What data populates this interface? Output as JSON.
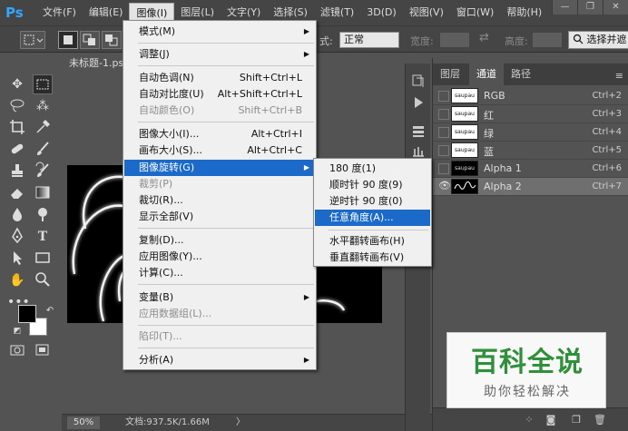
{
  "app": {
    "logo": "Ps"
  },
  "menubar": {
    "items": [
      "文件(F)",
      "编辑(E)",
      "图像(I)",
      "图层(L)",
      "文字(Y)",
      "选择(S)",
      "滤镜(T)",
      "3D(D)",
      "视图(V)",
      "窗口(W)",
      "帮助(H)"
    ],
    "active_index": 2
  },
  "window_controls": {
    "minimize": "—",
    "restore": "❐",
    "close": "✕"
  },
  "options_bar": {
    "style_label": "式:",
    "style_value": "正常",
    "width_label": "宽度:",
    "height_label": "高度:",
    "select_mask_button": "选择并遮"
  },
  "document": {
    "tab_title": "未标题-1.psd",
    "zoom": "50%",
    "doc_info": "文档:937.5K/1.66M",
    "status_arrow": "〉"
  },
  "image_menu": {
    "items": [
      {
        "label": "模式(M)",
        "shortcut": "",
        "submenu": true,
        "disabled": false
      },
      {
        "label": "调整(J)",
        "shortcut": "",
        "submenu": true,
        "disabled": false
      },
      {
        "label": "自动色调(N)",
        "shortcut": "Shift+Ctrl+L",
        "submenu": false,
        "disabled": false
      },
      {
        "label": "自动对比度(U)",
        "shortcut": "Alt+Shift+Ctrl+L",
        "submenu": false,
        "disabled": false
      },
      {
        "label": "自动颜色(O)",
        "shortcut": "Shift+Ctrl+B",
        "submenu": false,
        "disabled": true
      },
      {
        "label": "图像大小(I)...",
        "shortcut": "Alt+Ctrl+I",
        "submenu": false,
        "disabled": false
      },
      {
        "label": "画布大小(S)...",
        "shortcut": "Alt+Ctrl+C",
        "submenu": false,
        "disabled": false
      },
      {
        "label": "图像旋转(G)",
        "shortcut": "",
        "submenu": true,
        "disabled": false,
        "highlighted": true
      },
      {
        "label": "裁剪(P)",
        "shortcut": "",
        "submenu": false,
        "disabled": true
      },
      {
        "label": "裁切(R)...",
        "shortcut": "",
        "submenu": false,
        "disabled": false
      },
      {
        "label": "显示全部(V)",
        "shortcut": "",
        "submenu": false,
        "disabled": false
      },
      {
        "label": "复制(D)...",
        "shortcut": "",
        "submenu": false,
        "disabled": false
      },
      {
        "label": "应用图像(Y)...",
        "shortcut": "",
        "submenu": false,
        "disabled": false
      },
      {
        "label": "计算(C)...",
        "shortcut": "",
        "submenu": false,
        "disabled": false
      },
      {
        "label": "变量(B)",
        "shortcut": "",
        "submenu": true,
        "disabled": false
      },
      {
        "label": "应用数据组(L)...",
        "shortcut": "",
        "submenu": false,
        "disabled": true
      },
      {
        "label": "陷印(T)...",
        "shortcut": "",
        "submenu": false,
        "disabled": true
      },
      {
        "label": "分析(A)",
        "shortcut": "",
        "submenu": true,
        "disabled": false
      }
    ]
  },
  "rotation_submenu": {
    "items": [
      {
        "label": "180 度(1)"
      },
      {
        "label": "顺时针 90 度(9)"
      },
      {
        "label": "逆时针 90 度(0)"
      },
      {
        "label": "任意角度(A)...",
        "highlighted": true
      },
      {
        "label": "水平翻转画布(H)"
      },
      {
        "label": "垂直翻转画布(V)"
      }
    ]
  },
  "channels_panel": {
    "tabs": [
      "图层",
      "通道",
      "路径"
    ],
    "active_tab": 1,
    "menu_icon": "≡",
    "channels": [
      {
        "name": "RGB",
        "shortcut": "Ctrl+2",
        "thumb": "saupau",
        "visible": false,
        "selected": false
      },
      {
        "name": "红",
        "shortcut": "Ctrl+3",
        "thumb": "saupau",
        "visible": false,
        "selected": false
      },
      {
        "name": "绿",
        "shortcut": "Ctrl+4",
        "thumb": "saupau",
        "visible": false,
        "selected": false
      },
      {
        "name": "蓝",
        "shortcut": "Ctrl+5",
        "thumb": "saupau",
        "visible": false,
        "selected": false
      },
      {
        "name": "Alpha 1",
        "shortcut": "Ctrl+6",
        "thumb": "saupau",
        "visible": false,
        "selected": false
      },
      {
        "name": "Alpha 2",
        "shortcut": "Ctrl+7",
        "thumb": "",
        "visible": true,
        "selected": true
      }
    ]
  },
  "watermark": {
    "title": "百科全说",
    "subtitle": "助你轻松解决"
  },
  "colors": {
    "menu_highlight": "#1b6ac9",
    "app_bg": "#535353",
    "logo": "#31a8ff",
    "watermark_green": "#2f8f3a"
  }
}
